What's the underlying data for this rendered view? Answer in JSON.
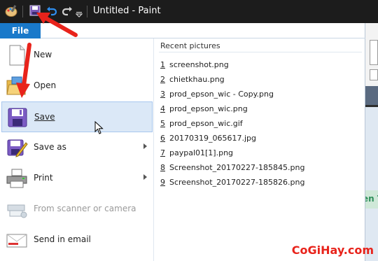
{
  "window": {
    "title": "Untitled - Paint"
  },
  "file_menu": {
    "tab_label": "File",
    "commands": [
      {
        "label": "New",
        "icon": "new-file-icon",
        "enabled": true
      },
      {
        "label": "Open",
        "icon": "open-folder-icon",
        "enabled": true
      },
      {
        "label": "Save",
        "icon": "save-icon",
        "enabled": true,
        "highlighted": true
      },
      {
        "label": "Save as",
        "icon": "save-as-icon",
        "enabled": true,
        "submenu": true
      },
      {
        "label": "Print",
        "icon": "printer-icon",
        "enabled": true,
        "submenu": true
      },
      {
        "label": "From scanner or camera",
        "icon": "scanner-icon",
        "enabled": false
      },
      {
        "label": "Send in email",
        "icon": "email-icon",
        "enabled": true
      }
    ]
  },
  "recent": {
    "title": "Recent pictures",
    "items": [
      {
        "num": "1",
        "name": "screenshot.png"
      },
      {
        "num": "2",
        "name": "chietkhau.png"
      },
      {
        "num": "3",
        "name": "prod_epson_wic - Copy.png"
      },
      {
        "num": "4",
        "name": "prod_epson_wic.png"
      },
      {
        "num": "5",
        "name": "prod_epson_wic.gif"
      },
      {
        "num": "6",
        "name": "20170319_065617.jpg"
      },
      {
        "num": "7",
        "name": "paypal01[1].png"
      },
      {
        "num": "8",
        "name": "Screenshot_20170227-185845.png"
      },
      {
        "num": "9",
        "name": "Screenshot_20170227-185826.png"
      }
    ]
  },
  "background": {
    "green_label_fragment": "en T"
  },
  "watermark": "CoGiHay.com",
  "colors": {
    "file_tab": "#1979ca",
    "highlight": "#dbe8f7",
    "arrow": "#e8231b"
  }
}
